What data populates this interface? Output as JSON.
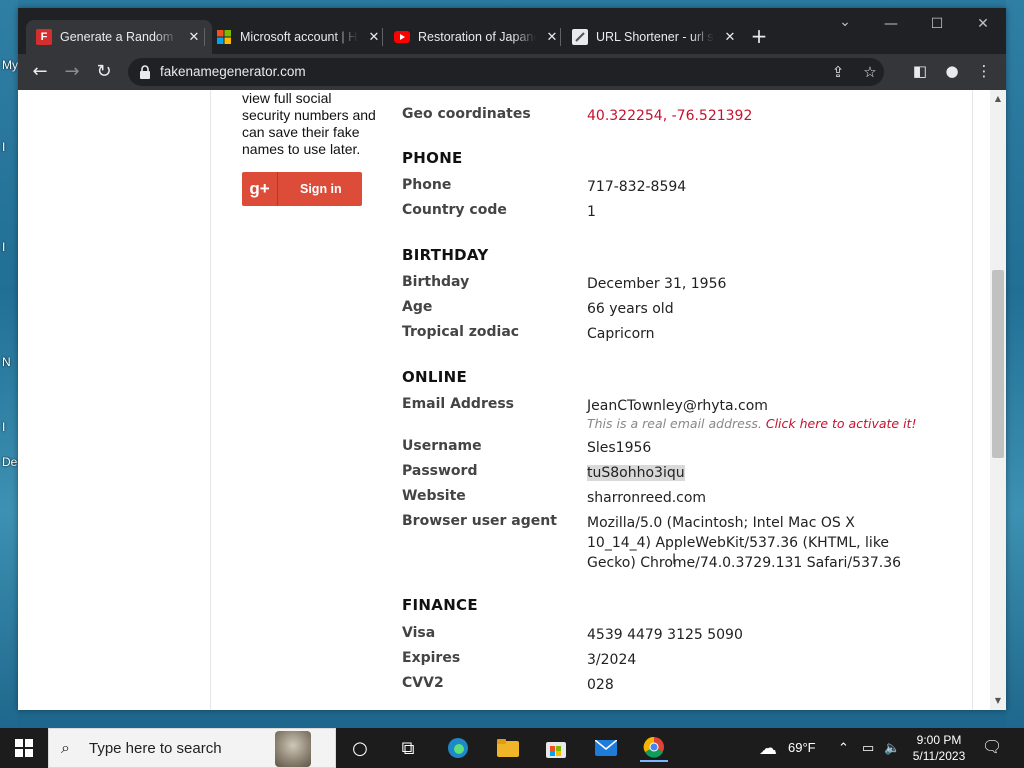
{
  "desktop": {
    "edge_letters": [
      "My",
      "I",
      "I",
      "N",
      "I",
      "De"
    ]
  },
  "browser": {
    "tabs": [
      {
        "title": "Generate a Random Name - Fake Name Generator",
        "icon": "fakenamegenerator-favicon",
        "active": true
      },
      {
        "title": "Microsoft account | Home",
        "icon": "microsoft-favicon",
        "active": false
      },
      {
        "title": "Restoration of Japanese Army",
        "icon": "youtube-favicon",
        "active": false
      },
      {
        "title": "URL Shortener - url shortener",
        "icon": "url-shortener-favicon",
        "active": false
      }
    ],
    "new_tab": "+",
    "address": "fakenamegenerator.com",
    "window_controls": {
      "chevron": "⌄",
      "minimize": "—",
      "maximize": "☐",
      "close": "✕"
    }
  },
  "sidebar": {
    "promo_text": "view full social security numbers and can save their fake names to use later.",
    "google_signin": {
      "icon_text": "g+",
      "label": "Sign in"
    }
  },
  "profile": {
    "geo": {
      "label": "Geo coordinates",
      "value": "40.322254, -76.521392"
    },
    "phone_section": "PHONE",
    "phone": {
      "label": "Phone",
      "value": "717-832-8594"
    },
    "country_code": {
      "label": "Country code",
      "value": "1"
    },
    "birthday_section": "BIRTHDAY",
    "birthday": {
      "label": "Birthday",
      "value": "December 31, 1956"
    },
    "age": {
      "label": "Age",
      "value": "66 years old"
    },
    "zodiac": {
      "label": "Tropical zodiac",
      "value": "Capricorn"
    },
    "online_section": "ONLINE",
    "email": {
      "label": "Email Address",
      "value": "JeanCTownley@rhyta.com",
      "note": "This is a real email address.",
      "note_link": "Click here to activate it!"
    },
    "username": {
      "label": "Username",
      "value": "Sles1956"
    },
    "password": {
      "label": "Password",
      "value": "tuS8ohho3iqu"
    },
    "website": {
      "label": "Website",
      "value": "sharronreed.com"
    },
    "user_agent": {
      "label": "Browser user agent",
      "value": "Mozilla/5.0 (Macintosh; Intel Mac OS X 10_14_4) AppleWebKit/537.36 (KHTML, like Gecko) Chrome/74.0.3729.131 Safari/537.36"
    },
    "finance_section": "FINANCE",
    "visa": {
      "label": "Visa",
      "value": "4539 4479 3125 5090"
    },
    "expires": {
      "label": "Expires",
      "value": "3/2024"
    },
    "cvv2": {
      "label": "CVV2",
      "value": "028"
    }
  },
  "taskbar": {
    "search_placeholder": "Type here to search",
    "weather": "69°F",
    "time": "9:00 PM",
    "date": "5/11/2023"
  }
}
